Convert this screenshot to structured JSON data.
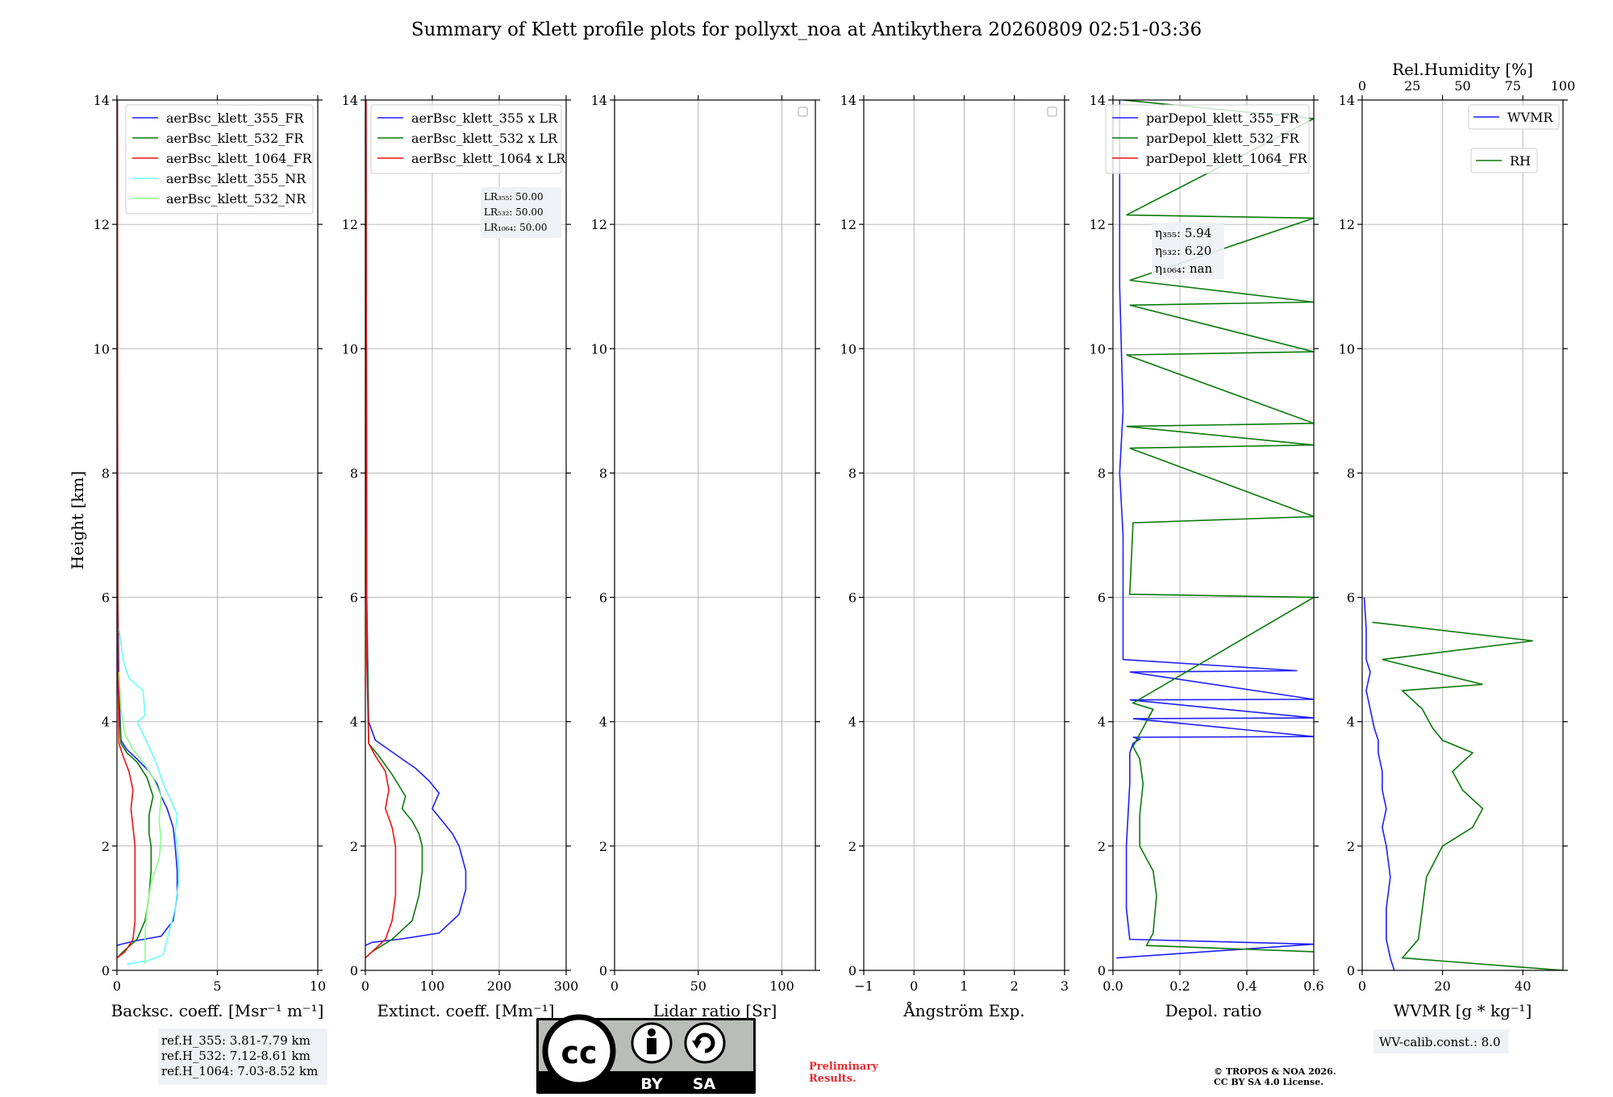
{
  "title": "Summary of Klett profile plots for pollyxt_noa at Antikythera 20260809 02:51-03:36",
  "colors": {
    "c355_fr": "#1f1fff",
    "c532_fr": "#0a7a0a",
    "c1064_fr": "#ee1111",
    "c355_nr": "#66ffff",
    "c532_nr": "#88ff88",
    "wvmr": "#1f1fff",
    "rh": "#0a7a0a"
  },
  "shared_y": {
    "label": "Height [km]",
    "range": [
      0,
      14
    ],
    "ticks": [
      "0",
      "2",
      "4",
      "6",
      "8",
      "10",
      "12",
      "14"
    ]
  },
  "chart_data": [
    {
      "type": "line",
      "panel": "backscatter",
      "xlabel": "Backsc. coeff. [Msr⁻¹ m⁻¹]",
      "xlim": [
        0,
        10
      ],
      "xticks": [
        "0",
        "5",
        "10"
      ],
      "legend_position": "top-right",
      "series": [
        {
          "name": "aerBsc_klett_355_FR",
          "color_key": "c355_fr",
          "x": [
            0.0,
            0.2,
            1.0,
            2.2,
            2.8,
            3.0,
            3.0,
            2.9,
            2.8,
            2.5,
            2.2,
            2.0,
            1.6,
            1.0,
            0.5,
            0.2,
            0.1,
            0.05,
            0.02,
            0.02
          ],
          "y": [
            0.4,
            0.42,
            0.48,
            0.55,
            0.8,
            1.2,
            1.6,
            2.0,
            2.3,
            2.6,
            2.8,
            3.0,
            3.2,
            3.4,
            3.55,
            3.7,
            4.5,
            6.0,
            10.0,
            14.0
          ]
        },
        {
          "name": "aerBsc_klett_532_FR",
          "color_key": "c532_fr",
          "x": [
            0.0,
            0.3,
            1.0,
            1.4,
            1.6,
            1.7,
            1.7,
            1.6,
            1.6,
            1.8,
            1.5,
            1.0,
            0.5,
            0.2,
            0.06,
            0.03,
            0.02
          ],
          "y": [
            0.2,
            0.3,
            0.5,
            0.8,
            1.2,
            1.6,
            2.0,
            2.2,
            2.5,
            2.8,
            3.1,
            3.35,
            3.5,
            3.65,
            4.5,
            8.0,
            14.0
          ]
        },
        {
          "name": "aerBsc_klett_1064_FR",
          "color_key": "c1064_fr",
          "x": [
            0.0,
            0.4,
            0.8,
            0.9,
            0.9,
            0.9,
            0.9,
            0.8,
            0.7,
            0.8,
            0.6,
            0.3,
            0.1,
            0.04,
            0.02
          ],
          "y": [
            0.2,
            0.3,
            0.5,
            0.8,
            1.2,
            1.6,
            2.0,
            2.3,
            2.6,
            2.9,
            3.2,
            3.45,
            3.65,
            5.0,
            14.0
          ]
        },
        {
          "name": "aerBsc_klett_355_NR",
          "color_key": "c355_nr",
          "x": [
            0.5,
            1.5,
            2.3,
            2.5,
            2.9,
            3.1,
            3.0,
            2.9,
            3.0,
            2.6,
            2.3,
            2.0,
            1.6,
            1.3,
            1.0,
            1.4,
            1.3,
            0.6,
            0.3,
            0.1
          ],
          "y": [
            0.1,
            0.15,
            0.25,
            0.5,
            1.0,
            1.5,
            2.0,
            2.2,
            2.5,
            2.8,
            3.0,
            3.3,
            3.6,
            3.8,
            4.0,
            4.1,
            4.5,
            4.7,
            5.0,
            5.5
          ]
        },
        {
          "name": "aerBsc_klett_532_NR",
          "color_key": "c532_nr",
          "x": [
            1.4,
            1.4,
            1.5,
            1.7,
            2.1,
            2.2,
            2.1,
            2.2,
            1.8,
            1.3,
            0.8,
            0.4,
            0.2,
            0.1
          ],
          "y": [
            0.1,
            0.6,
            1.0,
            1.4,
            1.8,
            2.1,
            2.4,
            2.8,
            3.1,
            3.35,
            3.55,
            3.8,
            4.2,
            4.8
          ]
        }
      ]
    },
    {
      "type": "line",
      "panel": "extinction",
      "xlabel": "Extinct. coeff. [Mm⁻¹]",
      "xlim": [
        0,
        300
      ],
      "xticks": [
        "0",
        "100",
        "200",
        "300"
      ],
      "legend_position": "top-right",
      "annotation": [
        "LR₃₅₅: 50.00",
        "LR₅₃₂: 50.00",
        "LR₁₀₆₄: 50.00"
      ],
      "series": [
        {
          "name": "aerBsc_klett_355 x LR",
          "color_key": "c355_fr",
          "x": [
            0,
            10,
            50,
            110,
            140,
            150,
            150,
            145,
            140,
            130,
            115,
            100,
            110,
            95,
            75,
            55,
            35,
            15,
            5,
            2,
            1
          ],
          "y": [
            0.4,
            0.45,
            0.5,
            0.6,
            0.9,
            1.3,
            1.6,
            1.8,
            2.0,
            2.2,
            2.4,
            2.6,
            2.85,
            3.05,
            3.25,
            3.4,
            3.55,
            3.7,
            4.0,
            6.0,
            14.0
          ]
        },
        {
          "name": "aerBsc_klett_532 x LR",
          "color_key": "c532_fr",
          "x": [
            0,
            10,
            40,
            70,
            80,
            85,
            85,
            80,
            70,
            55,
            60,
            40,
            20,
            5,
            2,
            1
          ],
          "y": [
            0.2,
            0.3,
            0.5,
            0.8,
            1.2,
            1.6,
            2.0,
            2.2,
            2.4,
            2.6,
            2.8,
            3.15,
            3.45,
            3.65,
            6.0,
            14.0
          ]
        },
        {
          "name": "aerBsc_klett_1064 x LR",
          "color_key": "c1064_fr",
          "x": [
            0,
            10,
            30,
            40,
            45,
            45,
            45,
            40,
            30,
            35,
            30,
            15,
            5,
            2,
            1
          ],
          "y": [
            0.2,
            0.3,
            0.5,
            0.8,
            1.2,
            1.6,
            2.0,
            2.3,
            2.6,
            2.9,
            3.2,
            3.45,
            3.65,
            5.0,
            14.0
          ]
        }
      ]
    },
    {
      "type": "line",
      "panel": "lidar_ratio",
      "xlabel": "Lidar ratio [Sr]",
      "xlim": [
        0,
        120
      ],
      "xticks": [
        "0",
        "50",
        "100"
      ],
      "series": []
    },
    {
      "type": "line",
      "panel": "angstrom",
      "xlabel": "Ångström Exp.",
      "xlim": [
        -1,
        3
      ],
      "xticks": [
        "−1",
        "0",
        "1",
        "2",
        "3"
      ],
      "series": []
    },
    {
      "type": "line",
      "panel": "depol",
      "xlabel": "Depol. ratio",
      "xlim": [
        0,
        0.6
      ],
      "xticks": [
        "0.0",
        "0.2",
        "0.4",
        "0.6"
      ],
      "legend_position": "top-right",
      "annotation": [
        "η₃₅₅: 5.94",
        "η₅₃₂: 6.20",
        "η₁₀₆₄: nan"
      ],
      "series": [
        {
          "name": "parDepol_klett_355_FR",
          "color_key": "c355_fr",
          "x": [
            0.01,
            0.6,
            0.05,
            0.04,
            0.04,
            0.05,
            0.05,
            0.06,
            0.08,
            0.06,
            0.6,
            0.06,
            0.6,
            0.05,
            0.6,
            0.05,
            0.55,
            0.03,
            0.03,
            0.03,
            0.02,
            0.03,
            0.02,
            0.02
          ],
          "y": [
            0.2,
            0.42,
            0.5,
            1.0,
            2.0,
            3.0,
            3.5,
            3.65,
            3.72,
            3.75,
            3.76,
            4.05,
            4.06,
            4.35,
            4.36,
            4.8,
            4.82,
            5.0,
            6.0,
            7.0,
            8.0,
            9.0,
            11.0,
            14.0
          ]
        },
        {
          "name": "parDepol_klett_532_FR",
          "color_key": "c532_fr",
          "x": [
            0.6,
            0.1,
            0.12,
            0.13,
            0.12,
            0.08,
            0.08,
            0.09,
            0.08,
            0.06,
            0.09,
            0.12,
            0.06,
            0.6,
            0.05,
            0.06,
            0.6,
            0.05,
            0.6,
            0.04,
            0.6,
            0.04,
            0.6,
            0.05,
            0.6,
            0.05,
            0.6,
            0.04,
            0.6,
            0.03
          ],
          "y": [
            0.3,
            0.4,
            0.6,
            1.2,
            1.6,
            2.0,
            2.5,
            3.0,
            3.4,
            3.6,
            3.9,
            4.2,
            4.3,
            6.0,
            6.05,
            7.2,
            7.3,
            8.4,
            8.45,
            8.75,
            8.8,
            9.9,
            9.95,
            10.7,
            10.75,
            11.1,
            12.1,
            12.15,
            13.7,
            14.0
          ]
        },
        {
          "name": "parDepol_klett_1064_FR",
          "color_key": "c1064_fr",
          "x": [],
          "y": []
        }
      ]
    },
    {
      "type": "line",
      "panel": "wvmr",
      "xlabel": "WVMR [g * kg⁻¹]",
      "xlim": [
        0,
        50
      ],
      "xticks": [
        "0",
        "20",
        "40"
      ],
      "top_axis": {
        "label": "Rel.Humidity [%]",
        "range": [
          0,
          100
        ],
        "ticks": [
          "0",
          "25",
          "50",
          "75",
          "100"
        ]
      },
      "legend_position": "top-right",
      "annotation": [
        "WV-calib.const.: 8.0"
      ],
      "series": [
        {
          "name": "WVMR",
          "color_key": "wvmr",
          "x": [
            8,
            7,
            6,
            6,
            7,
            6,
            5,
            6,
            5,
            5,
            4,
            4,
            3,
            2,
            1,
            2,
            1,
            1,
            0.5
          ],
          "y": [
            0.0,
            0.2,
            0.5,
            1.0,
            1.5,
            2.0,
            2.3,
            2.6,
            2.9,
            3.2,
            3.5,
            3.7,
            3.9,
            4.2,
            4.5,
            4.8,
            5.0,
            5.5,
            6.0
          ]
        },
        {
          "name": "RH",
          "color_key": "rh",
          "x": [
            100,
            20,
            28,
            30,
            32,
            40,
            55,
            60,
            50,
            45,
            55,
            40,
            35,
            30,
            20,
            60,
            10,
            85,
            5
          ],
          "y": [
            0.0,
            0.2,
            0.5,
            1.0,
            1.5,
            2.0,
            2.3,
            2.6,
            2.9,
            3.2,
            3.5,
            3.7,
            3.9,
            4.2,
            4.5,
            4.6,
            5.0,
            5.3,
            5.6
          ]
        }
      ]
    }
  ],
  "reference_heights": [
    "ref.H_355: 3.81-7.79 km",
    "ref.H_532: 7.12-8.61 km",
    "ref.H_1064: 7.03-8.52 km"
  ],
  "license_badge": {
    "icon": "cc-by-sa-icon",
    "by": "BY",
    "sa": "SA"
  },
  "preliminary": [
    "Preliminary",
    "Results."
  ],
  "copyright": [
    "© TROPOS & NOA 2026.",
    "CC BY SA 4.0 License."
  ]
}
